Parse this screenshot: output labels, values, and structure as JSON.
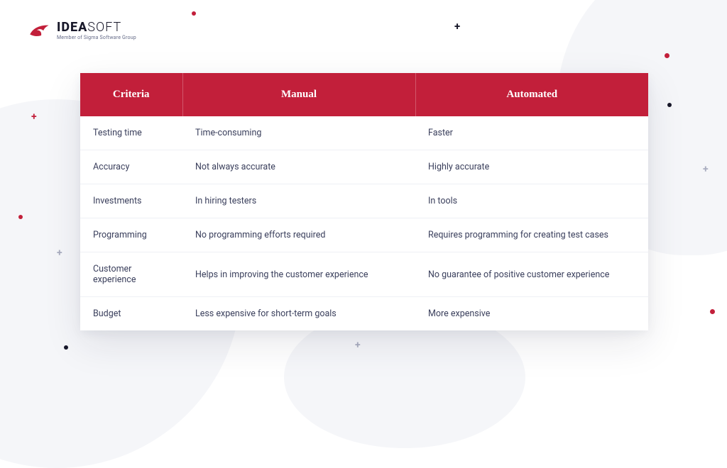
{
  "brand": {
    "name_bold": "IDEA",
    "name_light": "SOFT",
    "tagline": "Member of Sigma Software Group"
  },
  "table": {
    "headers": {
      "criteria": "Criteria",
      "manual": "Manual",
      "automated": "Automated"
    },
    "rows": [
      {
        "criteria": "Testing time",
        "manual": "Time-consuming",
        "automated": "Faster"
      },
      {
        "criteria": "Accuracy",
        "manual": "Not always accurate",
        "automated": "Highly accurate"
      },
      {
        "criteria": "Investments",
        "manual": "In hiring testers",
        "automated": "In tools"
      },
      {
        "criteria": "Programming",
        "manual": "No programming efforts required",
        "automated": "Requires programming for creating test cases"
      },
      {
        "criteria": "Customer experience",
        "manual": "Helps in improving the customer experience",
        "automated": "No guarantee of positive customer experience"
      },
      {
        "criteria": "Budget",
        "manual": "Less expensive for short-term goals",
        "automated": "More expensive"
      }
    ]
  },
  "colors": {
    "brand_red": "#c21f3a",
    "text_dark": "#3a3f5c",
    "bg_soft": "#f5f6f9"
  }
}
